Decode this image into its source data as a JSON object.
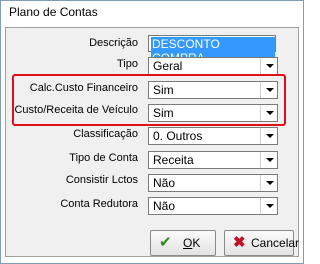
{
  "window": {
    "title": "Plano de Contas"
  },
  "form": {
    "descricao": {
      "label": "Descrição",
      "value": "DESCONTO COMPRA"
    },
    "tipo": {
      "label": "Tipo",
      "value": "Geral"
    },
    "calc_custo_financeiro": {
      "label": "Calc.Custo Financeiro",
      "value": "Sim"
    },
    "custo_receita_veiculo": {
      "label": "Custo/Receita de Veículo",
      "value": "Sim"
    },
    "classificacao": {
      "label": "Classificação",
      "value": "0. Outros"
    },
    "tipo_de_conta": {
      "label": "Tipo de Conta",
      "value": "Receita"
    },
    "consistir_lctos": {
      "label": "Consistir Lctos",
      "value": "Não"
    },
    "conta_redutora": {
      "label": "Conta Redutora",
      "value": "Não"
    }
  },
  "buttons": {
    "ok": {
      "label_first": "O",
      "label_rest": "K"
    },
    "cancel": {
      "label": "Cancelar"
    }
  },
  "colors": {
    "highlight": "#e0101a",
    "selection": "#3399ff",
    "ok_check": "#2a8a1a",
    "cancel_x": "#c0102a"
  },
  "icons": {
    "ok": "checkmark-icon",
    "cancel": "x-icon",
    "dropdown": "chevron-down-icon"
  }
}
